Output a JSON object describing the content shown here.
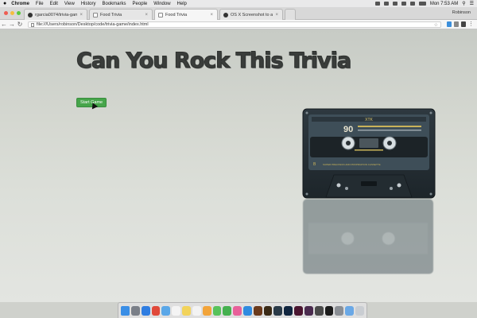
{
  "menubar": {
    "apple": "",
    "items": [
      "Chrome",
      "File",
      "Edit",
      "View",
      "History",
      "Bookmarks",
      "People",
      "Window",
      "Help"
    ],
    "battery": "",
    "clock": "Mon 7:53 AM"
  },
  "browser": {
    "tabs": [
      {
        "label": "rgarcia0074/trivia-game",
        "icon": "github-icon"
      },
      {
        "label": "Food Trivia",
        "icon": "page-icon"
      },
      {
        "label": "Food Trivia",
        "icon": "page-icon"
      },
      {
        "label": "OS X Screenshot to animated",
        "icon": "github-icon"
      }
    ],
    "profile_name": "Robinson",
    "address": "file:///Users/robinson/Desktop/code/trivia-game/index.html"
  },
  "page": {
    "title": "Can You Rock This Trivia",
    "start_button": "Start Game",
    "cassette": {
      "brand": "XTK",
      "length_mark": "90",
      "side_label": "B",
      "fine_print": "SUPER PRECISION ADD PROPRIATION CASSETTE"
    }
  },
  "dock": {
    "apps": [
      "finder-icon",
      "launchpad-icon",
      "safari-icon",
      "chrome-icon",
      "mail-icon",
      "calendar-icon",
      "notes-icon",
      "reminders-icon",
      "photos-icon",
      "messages-icon",
      "facetime-icon",
      "itunes-icon",
      "app-store-icon",
      "bridge-icon",
      "illustrator-icon",
      "lightroom-icon",
      "photoshop-icon",
      "indesign-icon",
      "slack-icon",
      "sublime-icon",
      "terminal-icon",
      "preferences-icon",
      "folder-icon",
      "trash-icon"
    ],
    "colors": {
      "finder-icon": "#3a8ee6",
      "launchpad-icon": "#7a7f88",
      "safari-icon": "#2f7de1",
      "chrome-icon": "#e0493a",
      "mail-icon": "#5aa7e8",
      "calendar-icon": "#f4f4f4",
      "notes-icon": "#f2d35b",
      "reminders-icon": "#f3f3f3",
      "photos-icon": "#f2a43a",
      "messages-icon": "#57c25b",
      "facetime-icon": "#45b04f",
      "itunes-icon": "#e8609a",
      "app-store-icon": "#2f8be0",
      "bridge-icon": "#6b3a1c",
      "illustrator-icon": "#3a2a16",
      "lightroom-icon": "#2a3a48",
      "photoshop-icon": "#10253f",
      "indesign-icon": "#4a1530",
      "slack-icon": "#4a2b4e",
      "sublime-icon": "#4a4a4a",
      "terminal-icon": "#1c1c1c",
      "preferences-icon": "#8a8e94",
      "folder-icon": "#6aa8e6",
      "trash-icon": "#c9cdd2"
    }
  }
}
